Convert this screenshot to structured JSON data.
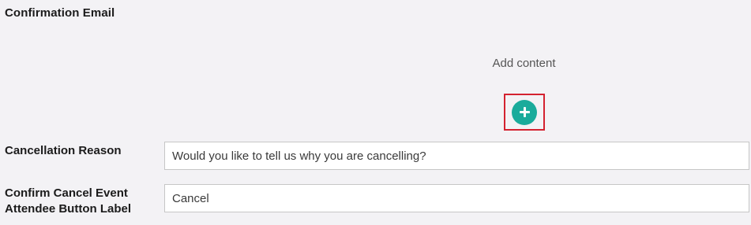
{
  "confirmation_email": {
    "title": "Confirmation Email",
    "add_content_label": "Add content",
    "add_button_icon": "plus-icon"
  },
  "cancellation_reason": {
    "label": "Cancellation Reason",
    "value": "Would you like to tell us why you are cancelling?"
  },
  "confirm_cancel": {
    "label": "Confirm Cancel Event Attendee Button Label",
    "value": "Cancel"
  },
  "colors": {
    "accent": "#1aab9b",
    "highlight_border": "#d42230",
    "background": "#f3f2f5"
  }
}
